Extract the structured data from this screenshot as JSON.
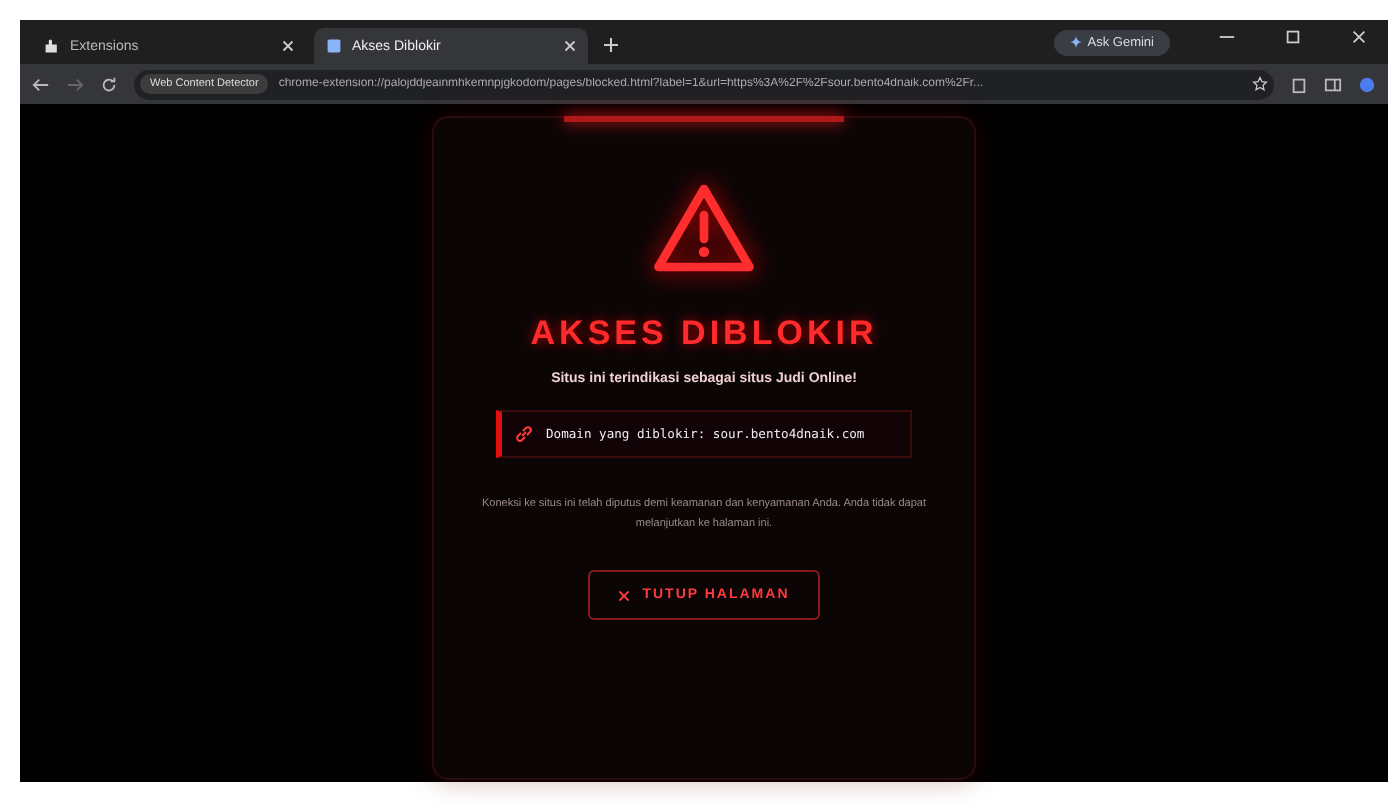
{
  "tabs": [
    {
      "label": "Extensions",
      "selected": false
    },
    {
      "label": "Akses Diblokir",
      "selected": true
    }
  ],
  "gemini_button": "Ask Gemini",
  "address_bar": {
    "site_chip": "Web Content Detector",
    "url": "chrome-extension://palojddjeainmhkemnpjgkodom/pages/blocked.html?label=1&url=https%3A%2F%2Fsour.bento4dnaik.com%2Fr..."
  },
  "card": {
    "title": "AKSES DIBLOKIR",
    "subtitle": "Situs ini terindikasi sebagai situs Judi Online!",
    "domain_line": "Domain yang diblokir: sour.bento4dnaik.com",
    "message": "Koneksi ke situs ini telah diputus demi keamanan dan kenyamanan Anda. Anda tidak dapat melanjutkan ke halaman ini.",
    "button": "TUTUP HALAMAN"
  }
}
